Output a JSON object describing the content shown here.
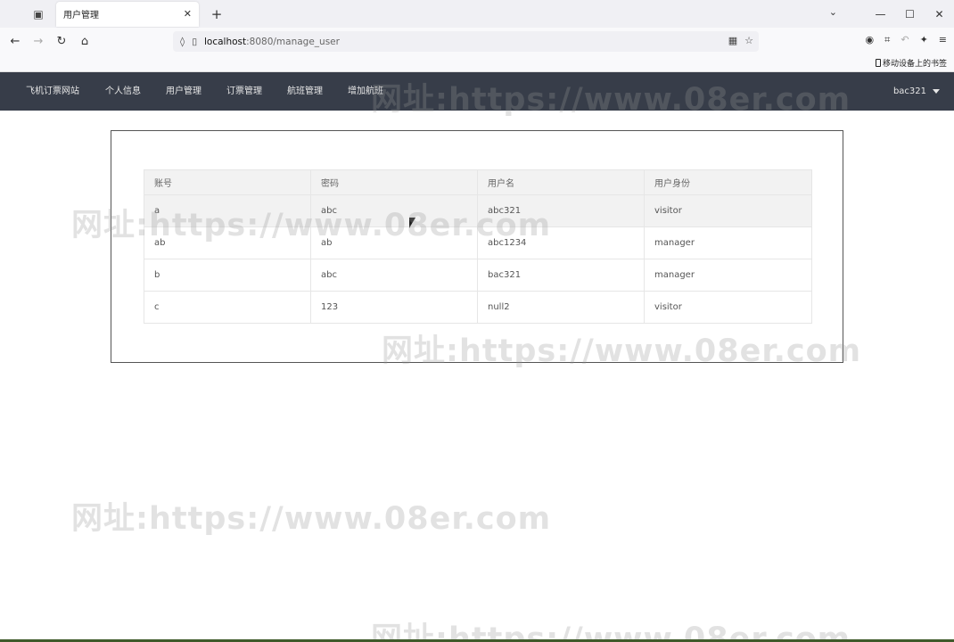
{
  "browser": {
    "tab_title": "用户管理",
    "tab_close": "✕",
    "new_tab": "+",
    "url_host": "localhost",
    "url_rest": ":8080/manage_user",
    "bookmark_mobile": "移动设备上的书签",
    "window_controls": [
      "—",
      "☐",
      "✕"
    ],
    "list_tabs": "⌄"
  },
  "site": {
    "brand": "飞机订票网站",
    "nav": [
      "个人信息",
      "用户管理",
      "订票管理",
      "航班管理",
      "增加航班"
    ],
    "user": "bac321"
  },
  "table": {
    "headers": [
      "账号",
      "密码",
      "用户名",
      "用户身份"
    ],
    "rows": [
      [
        "a",
        "abc",
        "abc321",
        "visitor"
      ],
      [
        "ab",
        "ab",
        "abc1234",
        "manager"
      ],
      [
        "b",
        "abc",
        "bac321",
        "manager"
      ],
      [
        "c",
        "123",
        "null2",
        "visitor"
      ]
    ]
  },
  "watermark": "网址:https://www.08er.com"
}
